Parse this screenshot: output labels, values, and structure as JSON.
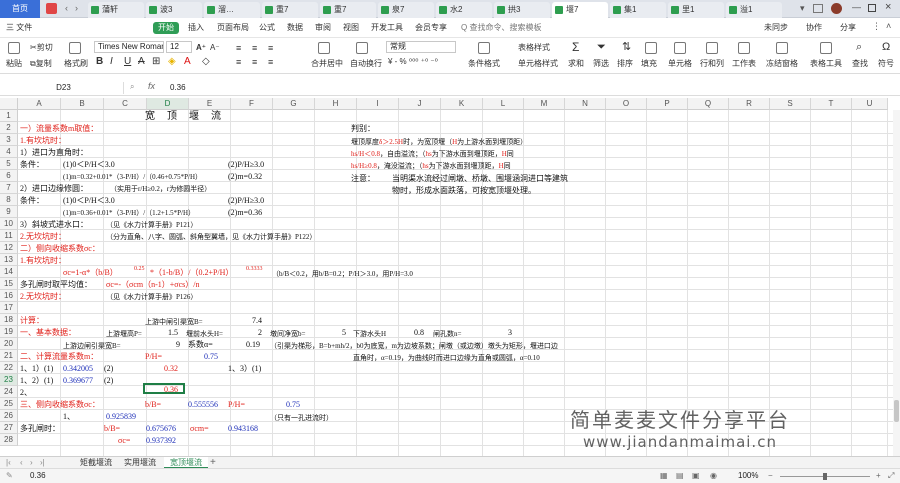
{
  "tabs": {
    "home": "首页",
    "docs": [
      "蒲轩",
      "波3",
      "溜…",
      "重7",
      "重7",
      "泉7",
      "水2",
      "拱3",
      "堰7",
      "集1",
      "里1",
      "溢1"
    ],
    "active_index": 8
  },
  "menu": {
    "file": "三 文件",
    "items": [
      "开始",
      "插入",
      "页面布局",
      "公式",
      "数据",
      "审阅",
      "视图",
      "开发工具",
      "会员专享"
    ],
    "search": "Q 查找命令、搜索模板",
    "right": [
      "未同步",
      "协作",
      "分享"
    ]
  },
  "toolbar": {
    "paste": "粘贴",
    "cut": "剪切",
    "copy": "复制",
    "format_painter": "格式刷",
    "font_name": "Times New Roman",
    "font_size": "12",
    "merge": "合并居中",
    "wrap": "自动换行",
    "number_format": "常规",
    "table_style": "表格样式",
    "cond_format": "条件格式",
    "cell_style": "单元格样式",
    "sum": "求和",
    "filter": "筛选",
    "sort": "排序",
    "fill": "填充",
    "cell": "单元格",
    "rowcol": "行和列",
    "sheet": "工作表",
    "freeze": "冻结窗格",
    "table_tools": "表格工具",
    "find": "查找",
    "symbol": "符号"
  },
  "formula_bar": {
    "cell_ref": "D23",
    "fx": "fx",
    "value": "0.36"
  },
  "columns": [
    "A",
    "B",
    "C",
    "D",
    "E",
    "F",
    "G",
    "H",
    "I",
    "J",
    "K",
    "L",
    "M",
    "N",
    "O",
    "P",
    "Q",
    "R",
    "S",
    "T",
    "U"
  ],
  "rows": [
    "1",
    "2",
    "3",
    "4",
    "5",
    "6",
    "7",
    "8",
    "9",
    "10",
    "11",
    "12",
    "13",
    "14",
    "15",
    "16",
    "17",
    "18",
    "19",
    "20",
    "21",
    "22",
    "23",
    "24",
    "25",
    "26",
    "27",
    "28"
  ],
  "cells": {
    "title": "宽　顶　堰　流",
    "r2_a": "一）流量系数m取值：",
    "r3_a": "1.有坎坑时：",
    "r4_a": "1）进口为直角时：",
    "r5_a": "条件：",
    "r5_c": "(1)0＜P/H＜3.0",
    "r5_f": "(2)P/H≥3.0",
    "r6_c": "(1)m=0.32+0.01*（3-P/H）/（0.46+0.75*P/H）",
    "r6_f": "(2)m=0.32",
    "r7_a": "2）进口边缘修圆：",
    "r7_c": "（实用于r/H≥0.2，r为修圆半径）",
    "r8_a": "条件：",
    "r8_c": "(1)0＜P/H＜3.0",
    "r8_f": "(2)P/H≥3.0",
    "r9_c": "(1)m=0.36+0.01*（3-P/H）/（1.2+1.5*P/H）",
    "r9_f": "(2)m=0.36",
    "r10_a": "3）斜坡式进水口：",
    "r10_c": "（见《水力计算手册》P121）",
    "r11_a": "2.无坎坑时：",
    "r11_c": "（分为直角、八字、圆弧、斜角型翼墙，见《水力计算手册》P122）",
    "r12_a": "二）侧向收缩系数σc：",
    "r13_a": "1.有坎坑时：",
    "r14_b": "σc=1-α*（b/B）",
    "r14_exp1": "0.25",
    "r14_d": "*（1-b/B）/（0.2+P/H）",
    "r14_exp2": "0.3333",
    "r14_g": "（b/B＜0.2，用b/B=0.2；P/H＞3.0，用P/H=3.0",
    "r15_a": "多孔闸时取平均值：",
    "r15_c": "σc=-（σcm（n-1）+σcs）/n",
    "r16_a": "2.无坎坑时：",
    "r16_c": "（见《水力计算手册》P126）",
    "r18_a": "计算：",
    "r18_d": "上游中闸引渠宽B=",
    "r18_f": "7.4",
    "r19_a": "一、基本数据：",
    "r19_c": "上游堰高P=",
    "r19_d": "1.5",
    "r19_e": "堰前水头H=",
    "r19_f": "2",
    "r19_g": "墩间净宽b=",
    "r19_h": "5",
    "r19_i": "下游水头H",
    "r19_j": "0.8",
    "r19_k": "闸孔数n=",
    "r19_l": "3",
    "r20_b": "上游边闸引渠宽B=",
    "r20_d": "9",
    "r20_e": "系数α=",
    "r20_f": "0.19",
    "r20_g": "（引渠为梯形，B=b+mh/2，b0为底宽，m为边坡系数；闸墩（或边墩）墩头为矩形，堰进口边",
    "r21_a": "二、计算流量系数m：",
    "r21_d": "P/H=",
    "r21_e": "0.75",
    "r21_i": "直角时，α=0.19，为曲线时而进口边缘为直角或圆弧，α=0.10",
    "r22_a": "1、1）(1)",
    "r22_b": "0.342005",
    "r22_c": "(2)",
    "r22_d": "0.32",
    "r22_f": "1、3）(1)",
    "r23_a": "1、2）(1)",
    "r23_b": "0.369677",
    "r23_c": "(2)",
    "r23_d": "0.36",
    "r24_a": "2、",
    "r25_a": "三、侧向收缩系数σc：",
    "r25_d": "b/B=",
    "r25_e": "0.555556",
    "r25_f": "P/H=",
    "r25_g": "0.75",
    "r26_b": "1、",
    "r26_c": "0.925839",
    "r26_f": "（只有一孔进流时）",
    "r27_a": "多孔闸时：",
    "r27_b": "b/B=",
    "r27_c": "0.675676",
    "r27_e": "σcm=",
    "r27_f": "0.943168",
    "r28_c": "σc=",
    "r28_d": "0.937392",
    "i_title": "判别：",
    "i_line1_a": "堰顶厚度",
    "i_line1_b": "δ＞2.5H",
    "i_line1_c": "时，为宽顶堰（",
    "i_line1_d": "H",
    "i_line1_e": "为上游水面到堰顶距）",
    "i_line2_a": "hs/H＜0.8",
    "i_line2_b": "，自由溢流；（",
    "i_line2_c": "hs",
    "i_line2_d": "为下游水面到堰顶距，",
    "i_line2_e": "H",
    "i_line2_f": "同",
    "i_line3_a": "hs/H≥0.8",
    "i_line3_b": "，淹没溢流；（",
    "i_line3_c": "hs",
    "i_line3_d": "为下游水面到堰顶距，",
    "i_line3_e": "H",
    "i_line3_f": "同",
    "i_note": "注意：",
    "i_note1": "当明渠水流经过闸墩、桥墩、围堰涵洞进口等建筑",
    "i_note2": "物时，形成水面跌落，可按宽顶堰处理。"
  },
  "sheets": [
    "矩截堰流",
    "实用堰流",
    "宽顶堰流"
  ],
  "active_sheet": 2,
  "status": {
    "left": "0.36",
    "zoom": "100%"
  },
  "watermark": {
    "cn": "简单麦麦文件分享平台",
    "url": "www.jiandanmaimai.cn"
  }
}
